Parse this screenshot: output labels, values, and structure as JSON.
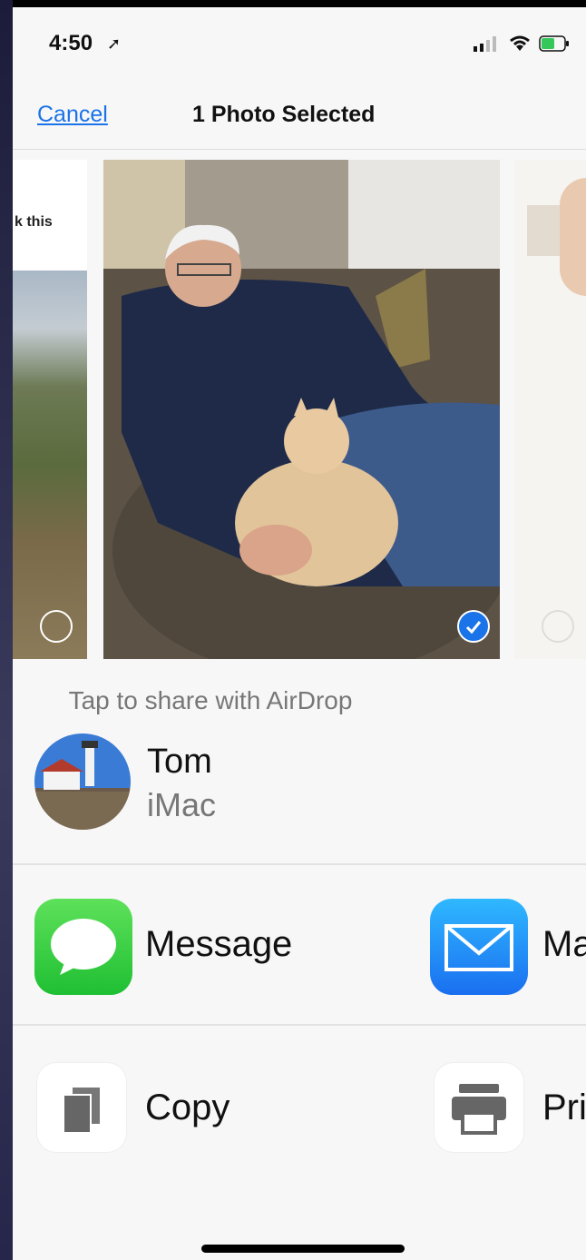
{
  "status_bar": {
    "time": "4:50"
  },
  "nav": {
    "cancel_label": "Cancel",
    "title": "1 Photo Selected"
  },
  "photos": {
    "left_snippet": "k this"
  },
  "airdrop": {
    "hint": "Tap to share with AirDrop",
    "person": "Tom",
    "device": "iMac"
  },
  "apps": [
    {
      "label": "Message",
      "icon": "messages-icon"
    },
    {
      "label": "Ma",
      "icon": "mail-icon"
    }
  ],
  "actions": [
    {
      "label": "Copy",
      "icon": "copy-icon"
    },
    {
      "label": "Pri",
      "icon": "print-icon"
    }
  ],
  "colors": {
    "accent": "#1a73e8",
    "messages_green": "#34c759",
    "mail_blue": "#1e90ff"
  }
}
